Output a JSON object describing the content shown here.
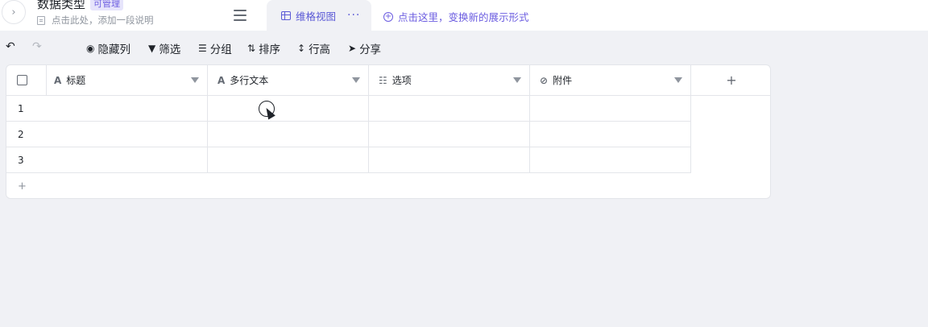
{
  "header": {
    "title": "数据类型",
    "permission_badge": "可管理",
    "description_placeholder": "点击此处，添加一段说明",
    "view_tab_label": "维格视图",
    "view_more": "···",
    "add_view_label": "点击这里，变换新的展示形式"
  },
  "toolbar": {
    "undo_icon": "undo-icon",
    "redo_icon": "redo-icon",
    "hide_columns": "隐藏列",
    "filter": "筛选",
    "group": "分组",
    "sort": "排序",
    "row_height": "行高",
    "share": "分享"
  },
  "table": {
    "columns": [
      {
        "label": "标题",
        "icon": "text-field-icon",
        "glyph": "A"
      },
      {
        "label": "多行文本",
        "icon": "text-field-icon",
        "glyph": "A"
      },
      {
        "label": "选项",
        "icon": "option-field-icon",
        "glyph": "☷"
      },
      {
        "label": "附件",
        "icon": "attachment-icon",
        "glyph": "⊘"
      }
    ],
    "add_column": "+",
    "rows": [
      "1",
      "2",
      "3"
    ],
    "add_row": "+"
  }
}
